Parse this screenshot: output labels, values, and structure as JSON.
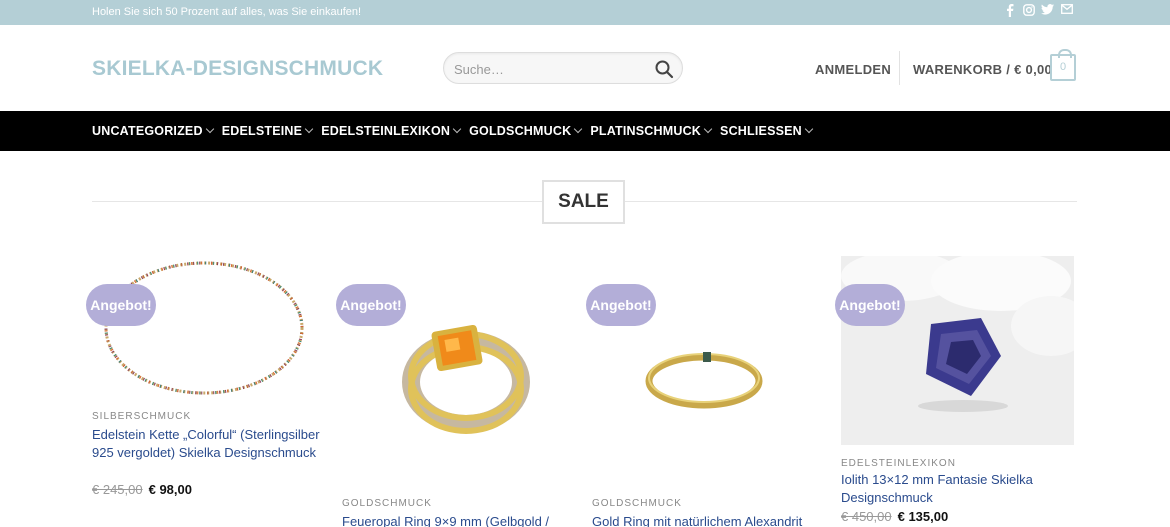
{
  "topbar": {
    "promo": "Holen Sie sich 50 Prozent auf alles, was Sie einkaufen!",
    "socials": [
      "facebook-icon",
      "instagram-icon",
      "twitter-icon",
      "email-icon"
    ]
  },
  "header": {
    "logo": "SKIELKA-DESIGNSCHMUCK",
    "search_placeholder": "Suche…",
    "login": "ANMELDEN",
    "cart": "WARENKORB / € 0,00",
    "cart_count": "0"
  },
  "nav": {
    "items": [
      "UNCATEGORIZED",
      "EDELSTEINE",
      "EDELSTEINLEXIKON",
      "GOLDSCHMUCK",
      "PLATINSCHMUCK",
      "SCHLIESSEN"
    ]
  },
  "section": {
    "title": "SALE"
  },
  "colors": {
    "accent": "#b4cfd6",
    "badge": "#b3aed8",
    "nav_bg": "#000000",
    "link": "#2a4b8d"
  },
  "products": [
    {
      "badge": "Angebot!",
      "category": "SILBERSCHMUCK",
      "title": "Edelstein Kette „Colorful“ (Sterlingsilber 925 vergoldet) Skielka Designschmuck",
      "old_price": "€ 245,00",
      "new_price": "€ 98,00"
    },
    {
      "badge": "Angebot!",
      "category": "GOLDSCHMUCK",
      "title": "Feueropal Ring 9×9 mm (Gelbgold /",
      "old_price": "",
      "new_price": ""
    },
    {
      "badge": "Angebot!",
      "category": "GOLDSCHMUCK",
      "title": "Gold Ring mit natürlichem Alexandrit",
      "old_price": "",
      "new_price": ""
    },
    {
      "badge": "Angebot!",
      "category": "EDELSTEINLEXIKON",
      "title": "Iolith 13×12 mm Fantasie Skielka Designschmuck",
      "old_price": "€ 450,00",
      "new_price": "€ 135,00"
    }
  ]
}
